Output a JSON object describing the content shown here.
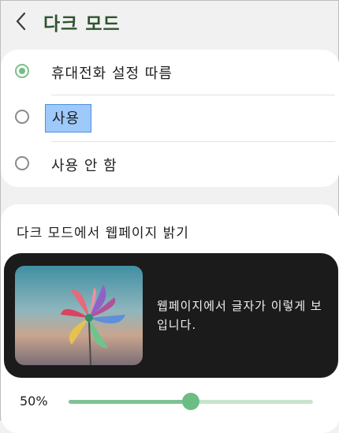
{
  "header": {
    "title": "다크 모드",
    "back_icon": "back-chevron-icon"
  },
  "dark_mode_options": [
    {
      "label": "휴대전화 설정 따름",
      "selected": true
    },
    {
      "label": "사용",
      "selected": false,
      "highlighted": true
    },
    {
      "label": "사용 안 함",
      "selected": false
    }
  ],
  "webpage_brightness": {
    "title": "다크 모드에서 웹페이지 밝기",
    "preview_text": "웹페이지에서 글자가 이렇게 보입니다.",
    "preview_image": "pinwheel-image",
    "value_label": "50%",
    "value": 0.5
  },
  "colors": {
    "accent": "#6bbd84",
    "title_green": "#2f5430",
    "selection_highlight": "#9ec9fb",
    "preview_background": "#1b1b1b"
  }
}
